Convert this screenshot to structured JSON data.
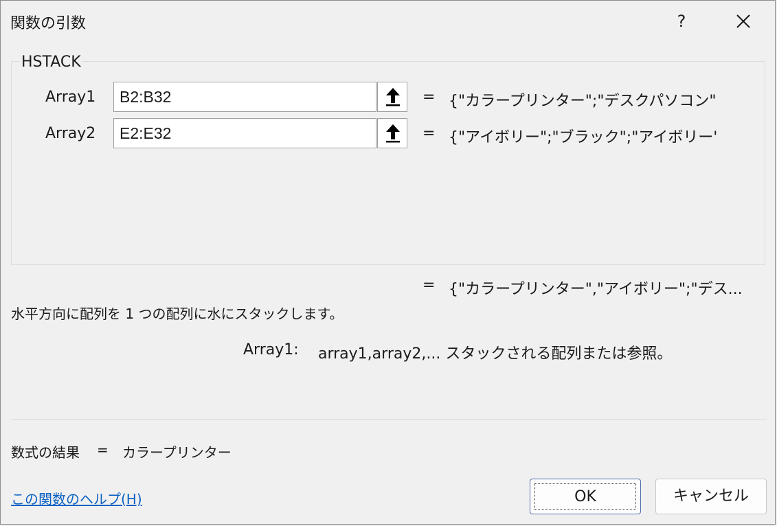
{
  "dialog": {
    "title": "関数の引数",
    "help_symbol": "?",
    "function_name": "HSTACK"
  },
  "args": [
    {
      "label": "Array1",
      "value": "B2:B32",
      "equals": "=",
      "evaluated": "{\"カラープリンター\";\"デスクパソコン\";\"デス"
    },
    {
      "label": "Array2",
      "value": "E2:E32",
      "equals": "=",
      "evaluated": "{\"アイボリー\";\"ブラック\";\"アイボリー\";\"..."
    }
  ],
  "result": {
    "equals": "=",
    "value": "{\"カラープリンター\",\"アイボリー\";\"デス..."
  },
  "description": "水平方向に配列を 1 つの配列に水にスタックします。",
  "arg_help": {
    "name": "Array1:",
    "text": "array1,array2,... スタックされる配列または参照。"
  },
  "formula_result": {
    "label": "数式の結果",
    "equals": "=",
    "value": "カラープリンター"
  },
  "help_link": "この関数のヘルプ(H)",
  "buttons": {
    "ok": "OK",
    "cancel": "キャンセル"
  },
  "icons": {
    "collapse": "arrow-up-icon",
    "close": "close-icon"
  }
}
